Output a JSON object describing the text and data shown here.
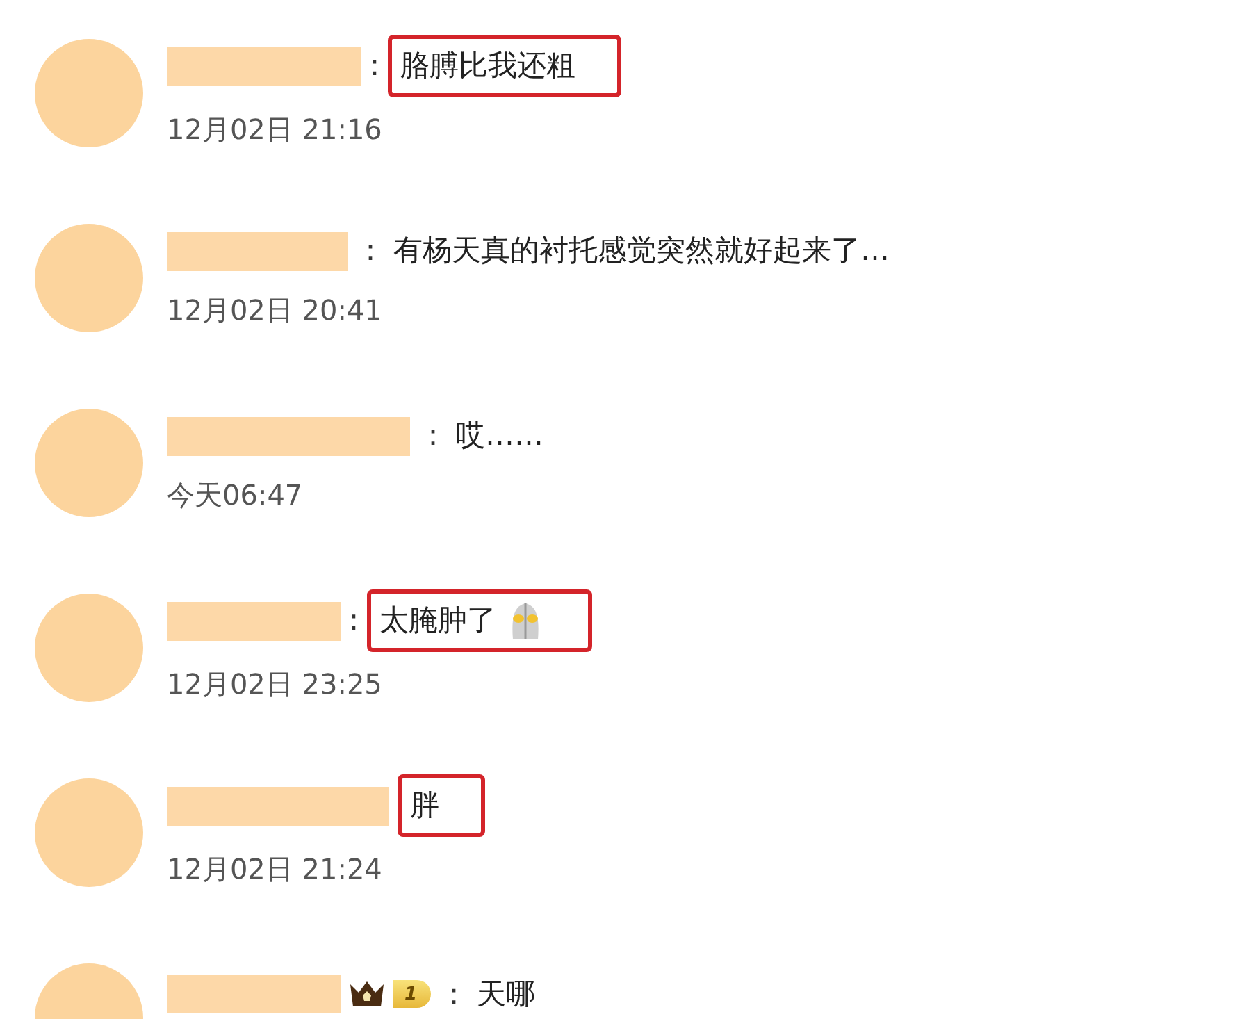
{
  "comments": [
    {
      "colon": ":",
      "text": "胳膊比我还粗",
      "highlighted": true,
      "time": "12月02日 21:16"
    },
    {
      "colon": "：",
      "text": "有杨天真的衬托感觉突然就好起来了…",
      "highlighted": false,
      "time": "12月02日 20:41"
    },
    {
      "colon": "：",
      "text": "哎……",
      "highlighted": false,
      "time": "今天06:47"
    },
    {
      "colon": ":",
      "text": "太腌肿了",
      "highlighted": true,
      "emoji": true,
      "time": "12月02日 23:25"
    },
    {
      "text": "胖",
      "highlighted": true,
      "time": "12月02日 21:24"
    },
    {
      "colon": "：",
      "text": "天哪",
      "highlighted": false,
      "badge": "1"
    }
  ]
}
